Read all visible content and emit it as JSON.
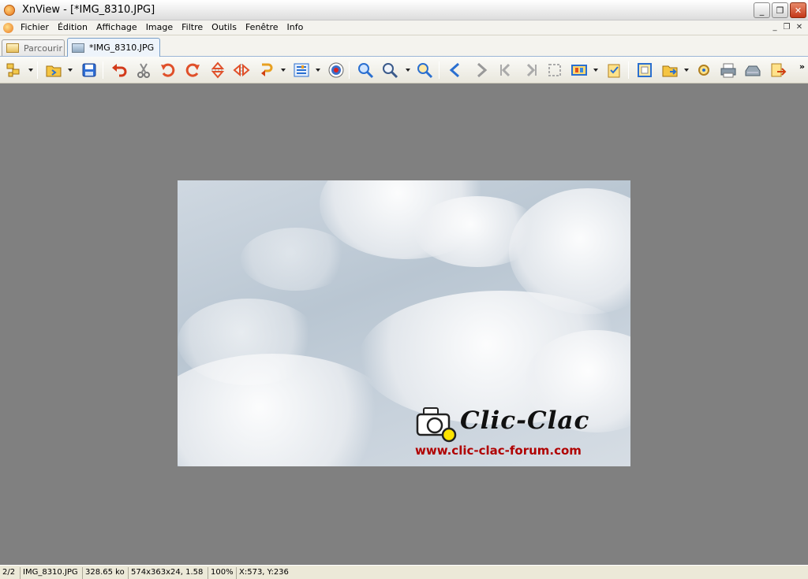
{
  "window": {
    "title": "XnView - [*IMG_8310.JPG]",
    "controls": {
      "minimize": "_",
      "maximize": "❐",
      "close": "✕"
    }
  },
  "menu": {
    "items": [
      "Fichier",
      "Édition",
      "Affichage",
      "Image",
      "Filtre",
      "Outils",
      "Fenêtre",
      "Info"
    ],
    "doc_controls": {
      "minimize": "_",
      "restore": "❐",
      "close": "✕"
    }
  },
  "tabs": [
    {
      "label": "Parcourir",
      "active": false
    },
    {
      "label": "*IMG_8310.JPG",
      "active": true
    }
  ],
  "toolbar": {
    "icons": [
      "browser-icon",
      "open-folder-icon",
      "save-icon",
      "undo-icon",
      "cut-icon",
      "rotate-left-icon",
      "rotate-right-icon",
      "flip-vertical-icon",
      "flip-horizontal-icon",
      "transform-icon",
      "adjust-icon",
      "red-eye-icon",
      "zoom-in-icon",
      "zoom-out-icon",
      "zoom-fit-icon",
      "previous-icon",
      "next-icon",
      "first-icon",
      "last-icon",
      "select-icon",
      "slideshow-icon",
      "bookmark-icon",
      "fullscreen-icon",
      "move-to-folder-icon",
      "batch-icon",
      "print-icon",
      "scan-icon",
      "export-icon"
    ],
    "overflow": "»"
  },
  "image": {
    "watermark_title": "Clic-Clac",
    "watermark_url": "www.clic-clac-forum.com"
  },
  "status": {
    "index": "2/2",
    "filename": "IMG_8310.JPG",
    "filesize": "328.65 ko",
    "dimensions": "574x363x24, 1.58",
    "zoom": "100%",
    "cursor": "X:573, Y:236"
  },
  "colors": {
    "viewer_background": "#808080",
    "watermark_url": "#b00000",
    "tab_active_border": "#7aa0c8"
  }
}
